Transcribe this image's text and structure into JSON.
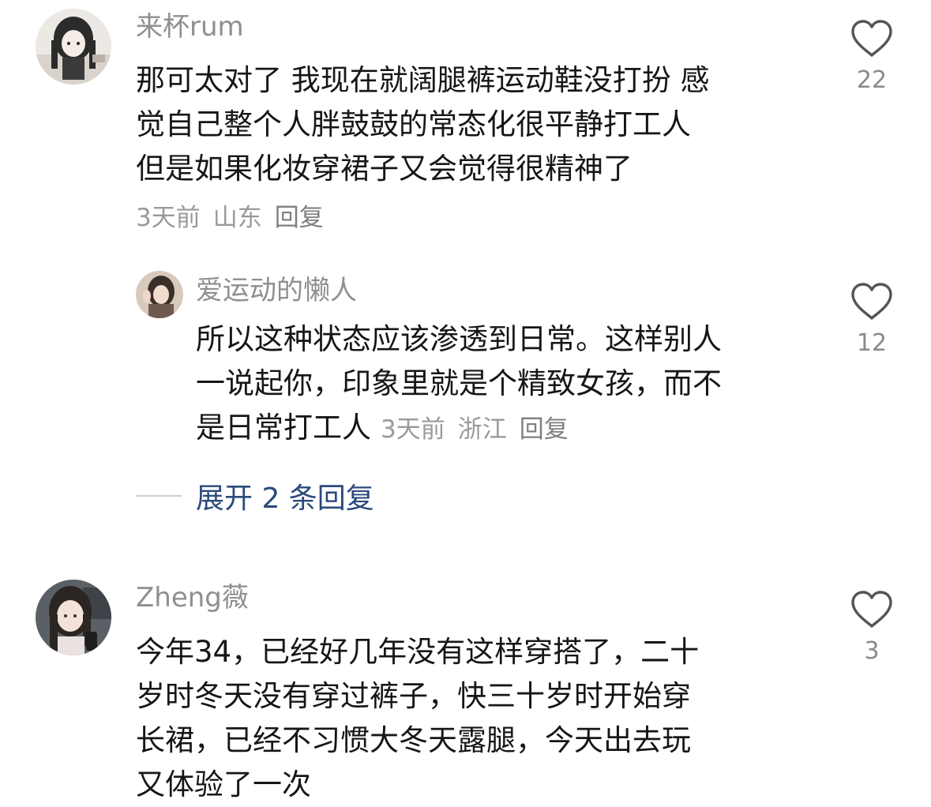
{
  "comments": [
    {
      "author": "来杯rum",
      "lines": [
        "那可太对了 我现在就阔腿裤运动鞋没打扮 感",
        "觉自己整个人胖鼓鼓的常态化很平静打工人",
        "但是如果化妆穿裙子又会觉得很精神了"
      ],
      "time": "3天前",
      "location": "山东",
      "reply_label": "回复",
      "likes": "22",
      "like_icon": "heart-outline-icon"
    },
    {
      "author": "爱运动的懒人",
      "lines": [
        "所以这种状态应该渗透到日常。这样别人",
        "一说起你，印象里就是个精致女孩，而不",
        "是日常打工人"
      ],
      "time": "3天前",
      "location": "浙江",
      "reply_label": "回复",
      "likes": "12",
      "like_icon": "heart-outline-icon"
    },
    {
      "author": "Zheng薇",
      "lines": [
        "今年34，已经好几年没有这样穿搭了，二十",
        "岁时冬天没有穿过裤子，快三十岁时开始穿",
        "长裙，已经不习惯大冬天露腿，今天出去玩",
        "又体验了一次"
      ],
      "likes": "3",
      "like_icon": "heart-outline-icon"
    }
  ],
  "expand_replies": {
    "label": "展开 2 条回复"
  },
  "colors": {
    "author": "#8f8f8f",
    "body": "#161616",
    "meta": "#9a9a9a",
    "expand_link": "#2a4a7b",
    "like_icon": "#555555"
  }
}
